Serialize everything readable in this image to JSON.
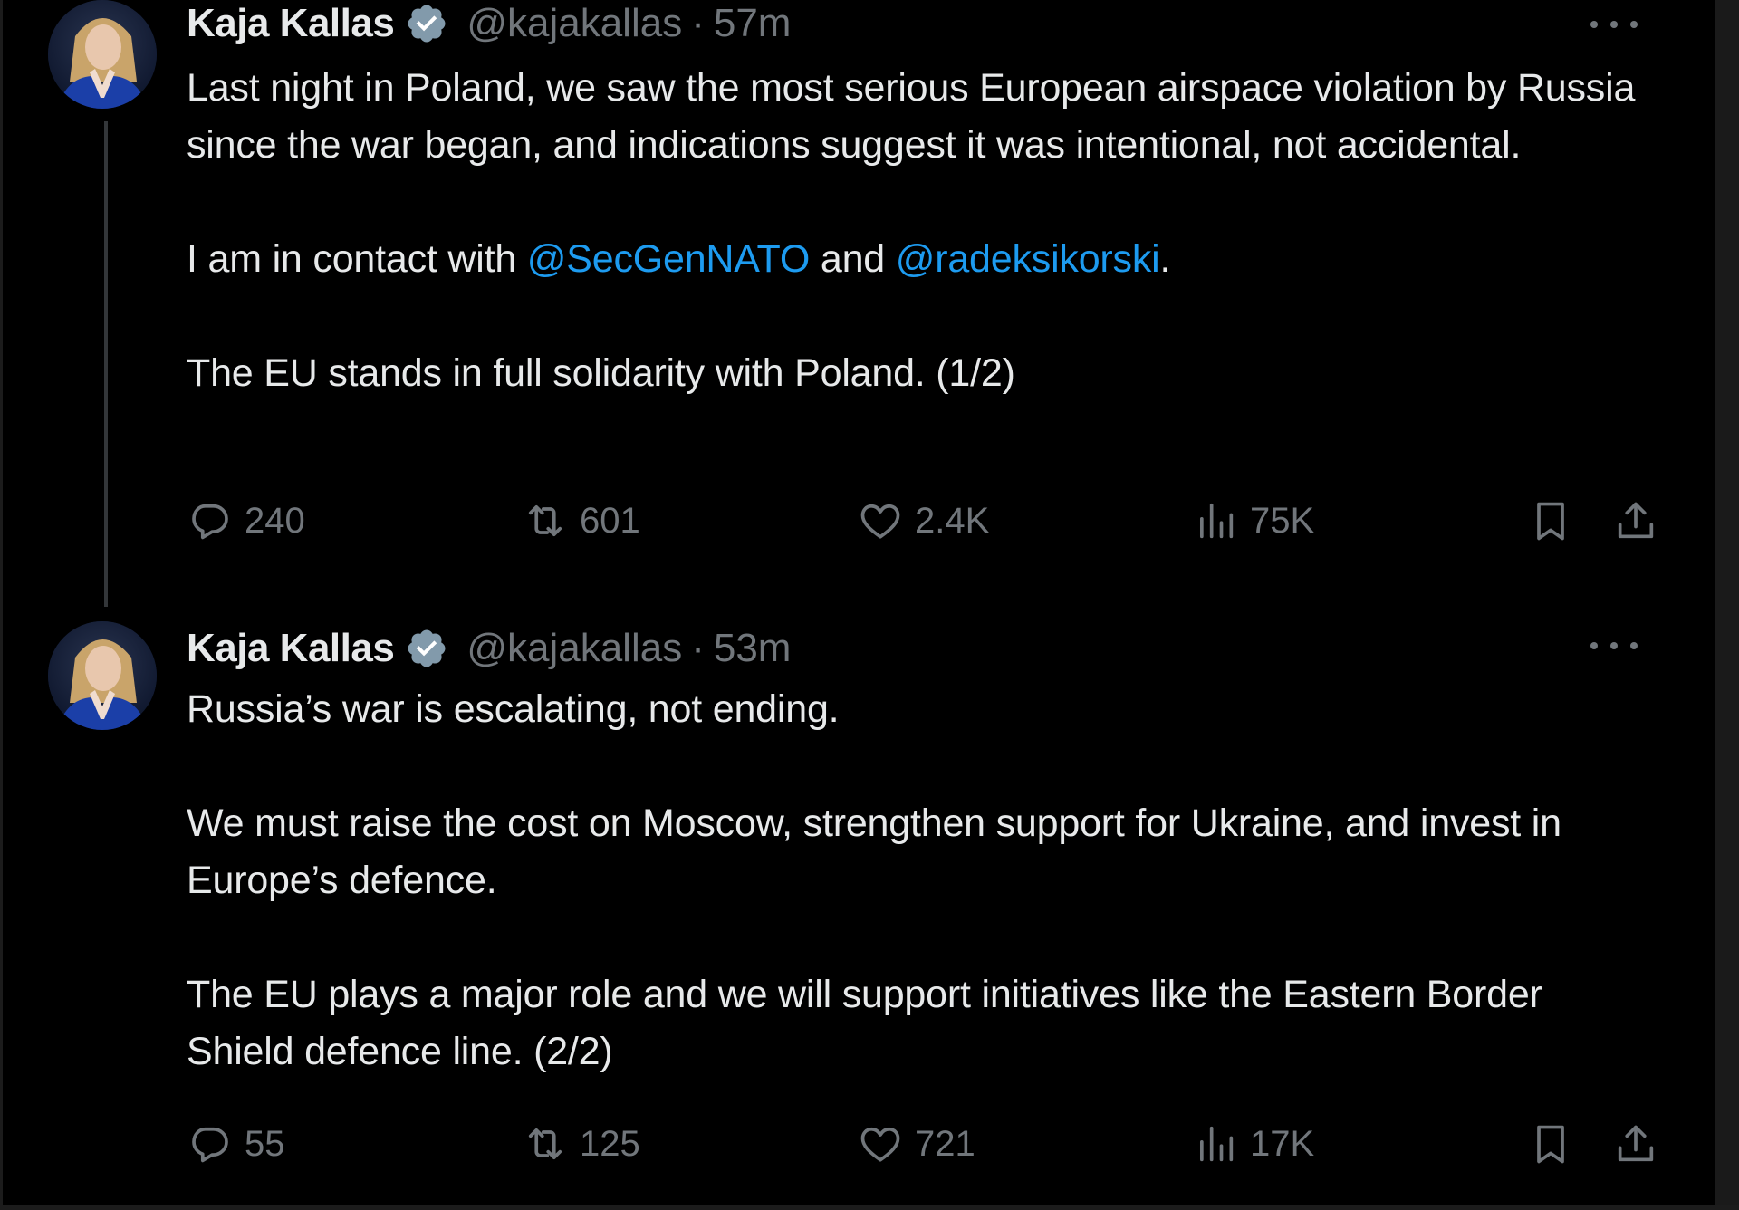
{
  "colors": {
    "background": "#000000",
    "text": "#e7e9ea",
    "muted": "#71767b",
    "mention": "#1d9bf0",
    "verified_badge": "#829aab"
  },
  "tweets": [
    {
      "display_name": "Kaja Kallas",
      "handle": "@kajakallas",
      "separator": "·",
      "time": "57m",
      "verified": true,
      "text": {
        "p1": "Last night in Poland, we saw the most serious European airspace violation by Russia since the war began, and indications suggest it was intentional, not accidental.",
        "p2_prefix": "I am in contact with ",
        "p2_mention1": "@SecGenNATO",
        "p2_middle": " and ",
        "p2_mention2": "@radeksikorski",
        "p2_suffix": ".",
        "p3": "The EU stands in full solidarity with Poland. (1/2)"
      },
      "stats": {
        "replies": "240",
        "reposts": "601",
        "likes": "2.4K",
        "views": "75K"
      }
    },
    {
      "display_name": "Kaja Kallas",
      "handle": "@kajakallas",
      "separator": "·",
      "time": "53m",
      "verified": true,
      "text": {
        "p1": "Russia’s war is escalating, not ending.",
        "p2": "We must raise the cost on Moscow, strengthen support for Ukraine, and invest in Europe’s defence.",
        "p3": "The EU plays a major role and we will support initiatives like the Eastern Border Shield defence line. (2/2)"
      },
      "stats": {
        "replies": "55",
        "reposts": "125",
        "likes": "721",
        "views": "17K"
      }
    }
  ],
  "icons": {
    "reply": "reply-icon",
    "repost": "repost-icon",
    "like": "heart-icon",
    "views": "views-icon",
    "bookmark": "bookmark-icon",
    "share": "share-icon",
    "more": "more-icon",
    "verified": "verified-badge-icon"
  }
}
